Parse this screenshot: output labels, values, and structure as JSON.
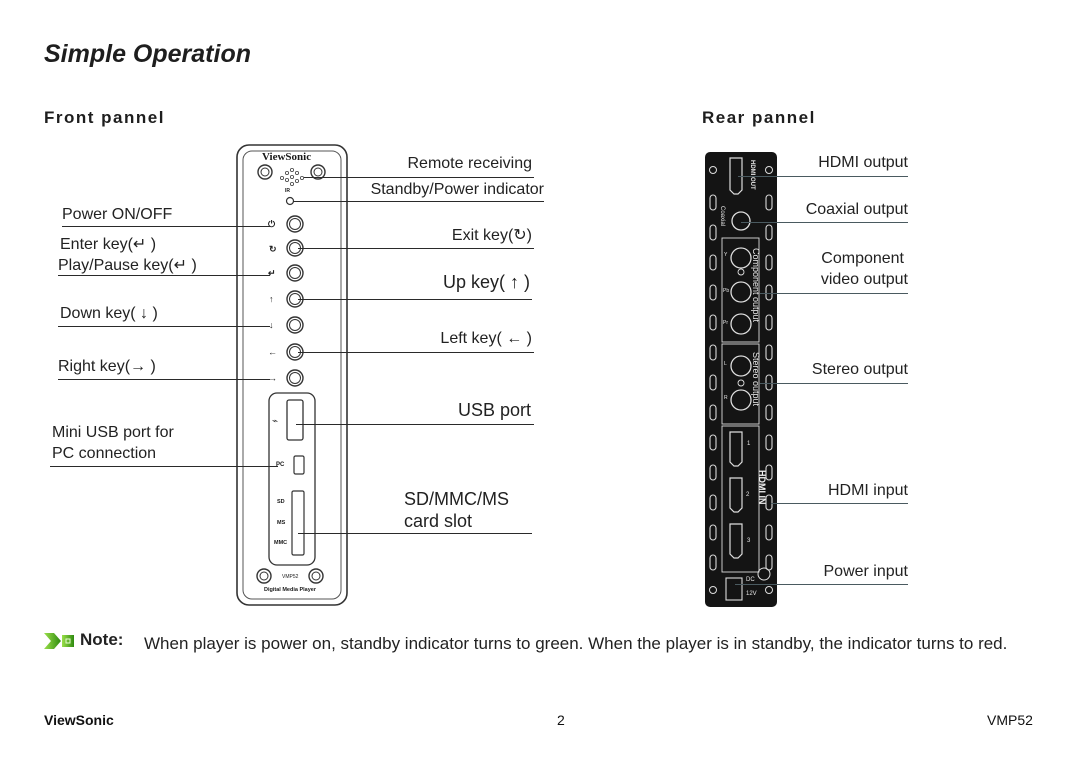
{
  "page": {
    "title": "Simple Operation",
    "front_section": "Front  pannel",
    "rear_section": "Rear  pannel"
  },
  "front_panel": {
    "brand_logo": "ViewSonic",
    "ir_label": "IR",
    "port_labels": {
      "pc": "PC",
      "sd": "SD",
      "ms": "MS",
      "mmc": "MMC"
    },
    "model": "VMP52",
    "product_name": "Digital Media Player",
    "callouts_left": {
      "power": "Power ON/OFF",
      "enter": "Enter key(↵ )",
      "play_pause": "Play/Pause key(↵ )",
      "down": "Down key( ↓ )",
      "right": "Right key(→ )",
      "mini_usb_line1": "Mini  USB port for",
      "mini_usb_line2": "PC connection"
    },
    "callouts_right": {
      "remote": "Remote receiving",
      "standby": "Standby/Power indicator",
      "exit": "Exit key(↻)",
      "up": "Up key(  ↑  )",
      "left": "Left key( ← )",
      "usb": "USB port",
      "card_line1": "SD/MMC/MS",
      "card_line2": "card slot"
    }
  },
  "rear_panel": {
    "device_labels": {
      "hdmi_out": "HDMI OUT",
      "coaxial": "Coaxial",
      "component": "Component output",
      "stereo": "Stereo output",
      "hdmi_in": "HDMI IN",
      "y": "Y",
      "pb": "Pb",
      "pr": "Pr",
      "l": "L",
      "r": "R",
      "in1": "1",
      "in2": "2",
      "in3": "3",
      "dc": "DC",
      "v12": "12V"
    },
    "callouts": {
      "hdmi_output": "HDMI  output",
      "coaxial_output": "Coaxial  output",
      "component_line1": "Component",
      "component_line2": "video output",
      "stereo_output": "Stereo output",
      "hdmi_input": "HDMI  input",
      "power_input": "Power input"
    }
  },
  "note": {
    "heading": "Note:",
    "text": "When player is power on, standby indicator turns to green. When the player is in standby, the indicator turns to red.",
    "icon": "green-arrow-note-icon",
    "icon_color": "#4caf1a"
  },
  "footer": {
    "brand": "ViewSonic",
    "page_number": "2",
    "model": "VMP52"
  }
}
